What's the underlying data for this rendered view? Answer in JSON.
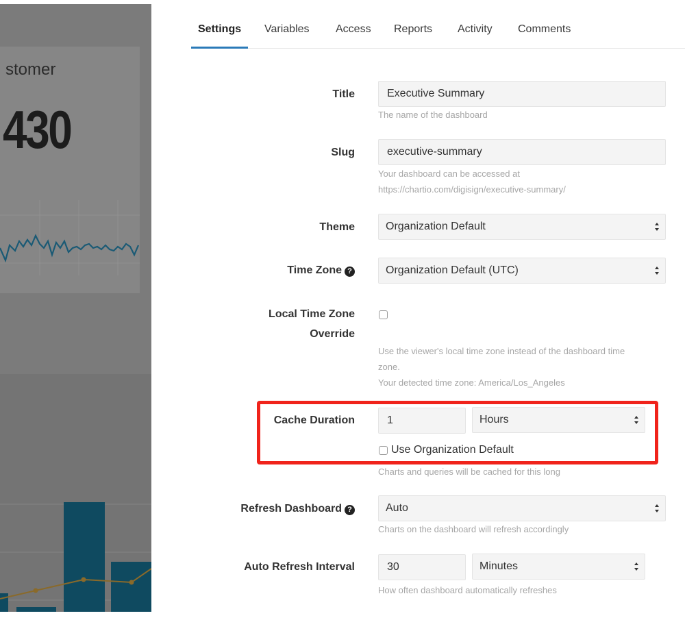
{
  "background_dashboard": {
    "metric_label": "stomer",
    "metric_value": "430"
  },
  "tabs": [
    {
      "label": "Settings",
      "active": true
    },
    {
      "label": "Variables",
      "active": false
    },
    {
      "label": "Access",
      "active": false
    },
    {
      "label": "Reports",
      "active": false
    },
    {
      "label": "Activity",
      "active": false
    },
    {
      "label": "Comments",
      "active": false
    }
  ],
  "form": {
    "title": {
      "label": "Title",
      "value": "Executive Summary",
      "help": "The name of the dashboard"
    },
    "slug": {
      "label": "Slug",
      "value": "executive-summary",
      "help_line1": "Your dashboard can be accessed at",
      "help_line2": "https://chartio.com/digisign/executive-summary/"
    },
    "theme": {
      "label": "Theme",
      "value": "Organization Default"
    },
    "time_zone": {
      "label": "Time Zone",
      "value": "Organization Default (UTC)",
      "help_icon": "question-circle-icon"
    },
    "local_tz_override": {
      "label_line1": "Local Time Zone",
      "label_line2": "Override",
      "checked": false,
      "help_line1": "Use the viewer's local time zone instead of the dashboard time",
      "help_line2": "zone.",
      "help_line3": "Your detected time zone: America/Los_Angeles"
    },
    "cache_duration": {
      "label": "Cache Duration",
      "value": "1",
      "unit": "Hours",
      "use_org_default_label": "Use Organization Default",
      "use_org_default_checked": false,
      "help": "Charts and queries will be cached for this long"
    },
    "refresh_dashboard": {
      "label": "Refresh Dashboard",
      "value": "Auto",
      "help": "Charts on the dashboard will refresh accordingly",
      "help_icon": "question-circle-icon"
    },
    "auto_refresh_interval": {
      "label": "Auto Refresh Interval",
      "value": "30",
      "unit": "Minutes",
      "help": "How often dashboard automatically refreshes"
    }
  },
  "colors": {
    "accent": "#2a7ab8",
    "highlight": "#f0231b"
  }
}
